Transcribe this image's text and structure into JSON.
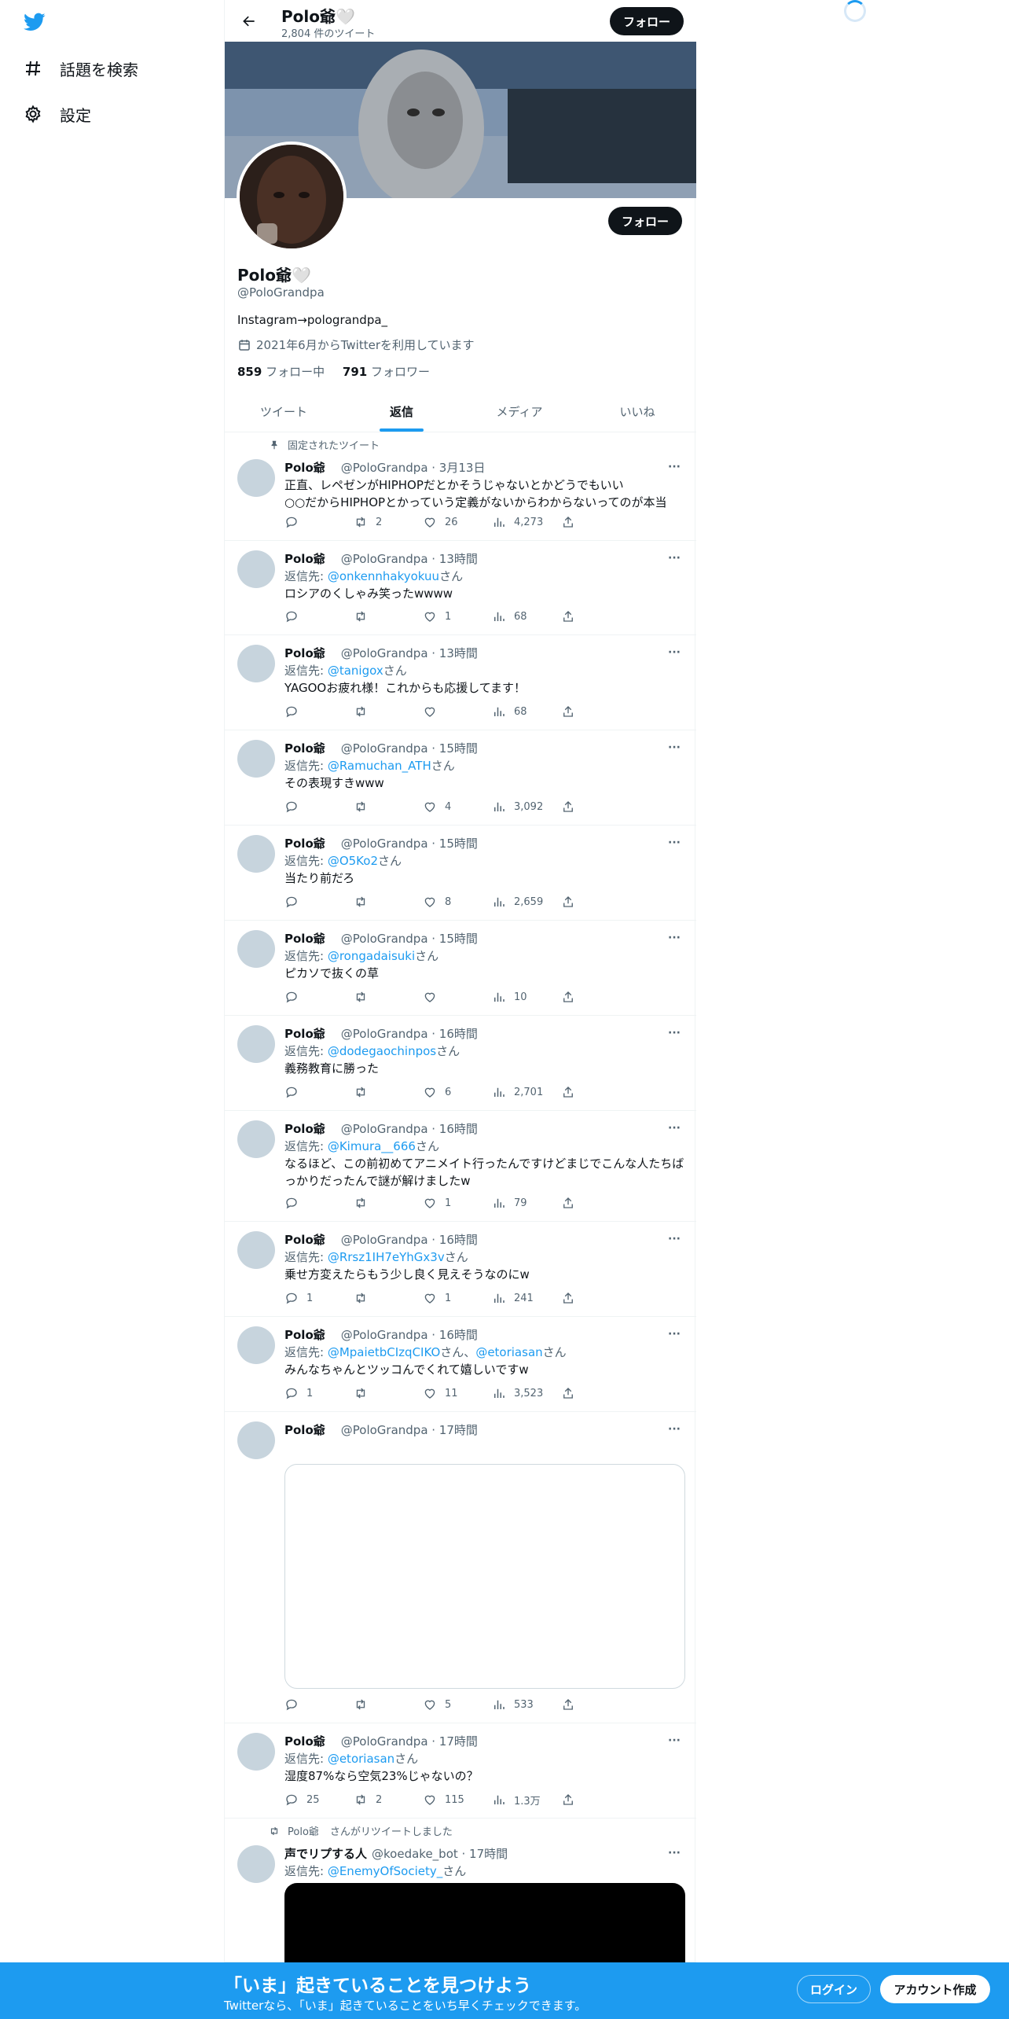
{
  "nav": {
    "items": [
      {
        "label": "話題を検索",
        "icon": "hashtag-icon"
      },
      {
        "label": "設定",
        "icon": "gear-icon"
      }
    ]
  },
  "topbar": {
    "name": "Polo爺🤍",
    "tweet_count": "2,804 件のツイート",
    "follow_label": "フォロー"
  },
  "profile": {
    "follow_label": "フォロー",
    "name": "Polo爺🤍",
    "handle": "@PoloGrandpa",
    "bio": "Instagram→polograndpa_",
    "joined": "2021年6月からTwitterを利用しています",
    "following_count": "859",
    "following_label": "フォロー中",
    "followers_count": "791",
    "followers_label": "フォロワー"
  },
  "tabs": [
    {
      "label": "ツイート",
      "active": false
    },
    {
      "label": "返信",
      "active": true
    },
    {
      "label": "メディア",
      "active": false
    },
    {
      "label": "いいね",
      "active": false
    }
  ],
  "pinned_label": "固定されたツイート",
  "retweeted_label": "さんがリツイートしました",
  "reply_prefix": "返信先: ",
  "reply_suffix": "さん",
  "tweets": [
    {
      "name": "Polo爺",
      "handle": "@PoloGrandpa · 3月13日",
      "text": "正直、レペゼンがHIPHOPだとかそうじゃないとかどうでもいい\n○○だからHIPHOPとかっていう定義がないからわからないってのが本当",
      "reply": "",
      "replies": "",
      "retweets": "2",
      "likes": "26",
      "views": "4,273"
    },
    {
      "name": "Polo爺",
      "handle": "@PoloGrandpa · 13時間",
      "reply": "@onkennhakyokuu",
      "text": "ロシアのくしゃみ笑ったwwww",
      "replies": "",
      "retweets": "",
      "likes": "1",
      "views": "68"
    },
    {
      "name": "Polo爺",
      "handle": "@PoloGrandpa · 13時間",
      "reply": "@tanigox",
      "text": "YAGOOお疲れ様！これからも応援してます！",
      "replies": "",
      "retweets": "",
      "likes": "",
      "views": "68"
    },
    {
      "name": "Polo爺",
      "handle": "@PoloGrandpa · 15時間",
      "reply": "@Ramuchan_ATH",
      "text": "その表現すきwww",
      "replies": "",
      "retweets": "",
      "likes": "4",
      "views": "3,092"
    },
    {
      "name": "Polo爺",
      "handle": "@PoloGrandpa · 15時間",
      "reply": "@O5Ko2",
      "text": "当たり前だろ",
      "replies": "",
      "retweets": "",
      "likes": "8",
      "views": "2,659"
    },
    {
      "name": "Polo爺",
      "handle": "@PoloGrandpa · 15時間",
      "reply": "@rongadaisuki",
      "text": "ピカソで抜くの草",
      "replies": "",
      "retweets": "",
      "likes": "",
      "views": "10"
    },
    {
      "name": "Polo爺",
      "handle": "@PoloGrandpa · 16時間",
      "reply": "@dodegaochinpos",
      "text": "義務教育に勝った",
      "replies": "",
      "retweets": "",
      "likes": "6",
      "views": "2,701"
    },
    {
      "name": "Polo爺",
      "handle": "@PoloGrandpa · 16時間",
      "reply": "@Kimura__666",
      "text": "なるほど、この前初めてアニメイト行ったんですけどまじでこんな人たちばっかりだったんで謎が解けましたw",
      "replies": "",
      "retweets": "",
      "likes": "1",
      "views": "79"
    },
    {
      "name": "Polo爺",
      "handle": "@PoloGrandpa · 16時間",
      "reply": "@Rrsz1IH7eYhGx3v",
      "text": "乗せ方変えたらもう少し良く見えそうなのにw",
      "replies": "1",
      "retweets": "",
      "likes": "1",
      "views": "241"
    },
    {
      "name": "Polo爺",
      "handle": "@PoloGrandpa · 16時間",
      "reply": "@MpaietbCIzqCIKO",
      "reply2": "@etoriasan",
      "reply_join": "さん、",
      "text": "みんなちゃんとツッコんでくれて嬉しいですw",
      "replies": "1",
      "retweets": "",
      "likes": "11",
      "views": "3,523"
    },
    {
      "name": "Polo爺",
      "handle": "@PoloGrandpa · 17時間",
      "reply": "",
      "text": "",
      "replies": "",
      "retweets": "",
      "likes": "5",
      "views": "533"
    },
    {
      "name": "Polo爺",
      "handle": "@PoloGrandpa · 17時間",
      "reply": "@etoriasan",
      "text": "湿度87%なら空気23%じゃないの？",
      "replies": "25",
      "retweets": "2",
      "likes": "115",
      "views": "1.3万"
    },
    {
      "retweeter": "Polo爺",
      "name": "声でリプする人",
      "handle": "@koedake_bot · 17時間",
      "reply": "@EnemyOfSociety_"
    }
  ],
  "bottom": {
    "title": "「いま」起きていることを見つけよう",
    "subtitle": "Twitterなら、「いま」起きていることをいち早くチェックできます。",
    "login_label": "ログイン",
    "signup_label": "アカウント作成"
  },
  "colors": {
    "accent": "#1d9bf0",
    "text": "#0f1419",
    "muted": "#536471"
  }
}
